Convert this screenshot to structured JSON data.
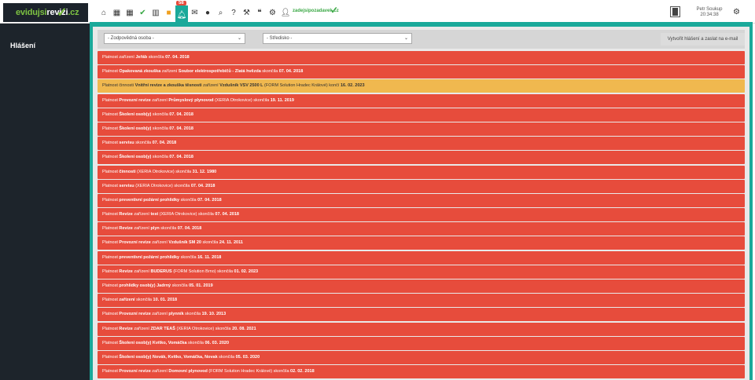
{
  "logo": {
    "part1": "evidujsi",
    "part2": "revizi",
    "part3": ".cz"
  },
  "topbar": {
    "notification_count": "58",
    "zadej_label": "zadejsipozadavek",
    "zadej_suffix": ".cz",
    "user_name": "Petr Soukup",
    "user_time": "20:34:38",
    "icons": [
      "home-icon",
      "calendar-icon",
      "calendar-icon",
      "check-icon",
      "bar-chart-icon",
      "folder-icon",
      "bell-icon",
      "envelope-icon",
      "info-icon",
      "search-icon",
      "help-icon",
      "gavel-icon",
      "quote-icon",
      "cog-icon",
      "user-icon"
    ]
  },
  "sidebar": {
    "title": "Hlášení"
  },
  "filters": {
    "responsible_person": "- Zodpovědná osoba -",
    "center": "- Středisko -",
    "send_button": "Vytvořit hlášení a zaslat na e-mail"
  },
  "colors": {
    "red": "#e74c3c",
    "yellow": "#f0b84f",
    "teal": "#1aa99a",
    "dark": "#1d242b"
  },
  "reports": [
    {
      "color": "red",
      "parts": [
        [
          "Platnost zařízení ",
          false
        ],
        [
          "Jeřáb",
          true
        ],
        [
          " skončila ",
          false
        ],
        [
          "07. 04. 2018",
          true
        ]
      ]
    },
    {
      "color": "red",
      "parts": [
        [
          "Platnost ",
          false
        ],
        [
          "Opakovaná zkouška",
          true
        ],
        [
          " zařízení ",
          false
        ],
        [
          "Soubor elektrospotřebičů - Zlatá hvězda",
          true
        ],
        [
          " skončila ",
          false
        ],
        [
          "07. 04. 2018",
          true
        ]
      ]
    },
    {
      "color": "yellow",
      "parts": [
        [
          "Platnost činnosti ",
          false
        ],
        [
          "Vnitřní revize a zkouška těsnosti",
          true
        ],
        [
          " zařízení ",
          false
        ],
        [
          "Vzdušník VSV 2500 L",
          true
        ],
        [
          " (FORM Solution Hradec Králové) končí ",
          false
        ],
        [
          "16. 02. 2023",
          true
        ]
      ]
    },
    {
      "color": "red",
      "parts": [
        [
          "Platnost ",
          false
        ],
        [
          "Provozní revize",
          true
        ],
        [
          " zařízení ",
          false
        ],
        [
          "Průmyslový plynovod",
          true
        ],
        [
          " (XERIA Otrokovice) skončila ",
          false
        ],
        [
          "19. 11. 2019",
          true
        ]
      ]
    },
    {
      "color": "red",
      "parts": [
        [
          "Platnost ",
          false
        ],
        [
          "Školení osob(y)",
          true
        ],
        [
          " skončila ",
          false
        ],
        [
          "07. 04. 2018",
          true
        ]
      ]
    },
    {
      "color": "red",
      "parts": [
        [
          "Platnost ",
          false
        ],
        [
          "Školení osob(y)",
          true
        ],
        [
          " skončila ",
          false
        ],
        [
          "07. 04. 2018",
          true
        ]
      ]
    },
    {
      "color": "red",
      "parts": [
        [
          "Platnost ",
          false
        ],
        [
          "servisu",
          true
        ],
        [
          " skončila ",
          false
        ],
        [
          "07. 04. 2018",
          true
        ]
      ]
    },
    {
      "color": "red",
      "parts": [
        [
          "Platnost ",
          false
        ],
        [
          "Školení osob(y)",
          true
        ],
        [
          " skončila ",
          false
        ],
        [
          "07. 04. 2018",
          true
        ]
      ]
    },
    {
      "color": "red",
      "parts": [
        [
          "Platnost ",
          false
        ],
        [
          "činnosti",
          true
        ],
        [
          " (XERIA Otrokovice) skončila ",
          false
        ],
        [
          "31. 12. 1980",
          true
        ]
      ]
    },
    {
      "color": "red",
      "parts": [
        [
          "Platnost ",
          false
        ],
        [
          "servisu",
          true
        ],
        [
          " (XERIA Otrokovice) skončila ",
          false
        ],
        [
          "07. 04. 2018",
          true
        ]
      ]
    },
    {
      "color": "red",
      "parts": [
        [
          "Platnost ",
          false
        ],
        [
          "preventivní požární prohlídky",
          true
        ],
        [
          " skončila ",
          false
        ],
        [
          "07. 04. 2018",
          true
        ]
      ]
    },
    {
      "color": "red",
      "parts": [
        [
          "Platnost ",
          false
        ],
        [
          "Revize",
          true
        ],
        [
          " zařízení ",
          false
        ],
        [
          "test",
          true
        ],
        [
          " (XERIA Otrokovice) skončila ",
          false
        ],
        [
          "07. 04. 2018",
          true
        ]
      ]
    },
    {
      "color": "red",
      "parts": [
        [
          "Platnost ",
          false
        ],
        [
          "Revize",
          true
        ],
        [
          " zařízení ",
          false
        ],
        [
          "plyn",
          true
        ],
        [
          " skončila ",
          false
        ],
        [
          "07. 04. 2018",
          true
        ]
      ]
    },
    {
      "color": "red",
      "parts": [
        [
          "Platnost ",
          false
        ],
        [
          "Provozní revize",
          true
        ],
        [
          " zařízení ",
          false
        ],
        [
          "Vzdušník SM 20",
          true
        ],
        [
          " skončila ",
          false
        ],
        [
          "24. 11. 2011",
          true
        ]
      ]
    },
    {
      "color": "red",
      "parts": [
        [
          "Platnost ",
          false
        ],
        [
          "preventivní požární prohlídky",
          true
        ],
        [
          " skončila ",
          false
        ],
        [
          "16. 11. 2018",
          true
        ]
      ]
    },
    {
      "color": "red",
      "parts": [
        [
          "Platnost ",
          false
        ],
        [
          "Revize",
          true
        ],
        [
          " zařízení ",
          false
        ],
        [
          "BUDERUS",
          true
        ],
        [
          " (FORM Solution Brno) skončila ",
          false
        ],
        [
          "01. 02. 2023",
          true
        ]
      ]
    },
    {
      "color": "red",
      "parts": [
        [
          "Platnost ",
          false
        ],
        [
          "prohlídky osob(y)",
          true
        ],
        [
          " ",
          false
        ],
        [
          "Jadrný",
          true
        ],
        [
          " skončila ",
          false
        ],
        [
          "05. 01. 2019",
          true
        ]
      ]
    },
    {
      "color": "red",
      "parts": [
        [
          "Platnost ",
          false
        ],
        [
          "zařízení",
          true
        ],
        [
          " skončila ",
          false
        ],
        [
          "10. 01. 2018",
          true
        ]
      ]
    },
    {
      "color": "red",
      "parts": [
        [
          "Platnost ",
          false
        ],
        [
          "Provozní revize",
          true
        ],
        [
          " zařízení ",
          false
        ],
        [
          "plynník",
          true
        ],
        [
          " skončila ",
          false
        ],
        [
          "19. 10. 2013",
          true
        ]
      ]
    },
    {
      "color": "red",
      "parts": [
        [
          "Platnost ",
          false
        ],
        [
          "Revize",
          true
        ],
        [
          " zařízení ",
          false
        ],
        [
          "ZDAR TEAŠ",
          true
        ],
        [
          " (XERIA Otrokovice) skončila ",
          false
        ],
        [
          "20. 08. 2021",
          true
        ]
      ]
    },
    {
      "color": "red",
      "parts": [
        [
          "Platnost ",
          false
        ],
        [
          "Školení osob(y)",
          true
        ],
        [
          " ",
          false
        ],
        [
          "Kvítko, Vomáčka",
          true
        ],
        [
          " skončila ",
          false
        ],
        [
          "06. 03. 2020",
          true
        ]
      ]
    },
    {
      "color": "red",
      "parts": [
        [
          "Platnost ",
          false
        ],
        [
          "Školení osob(y)",
          true
        ],
        [
          " ",
          false
        ],
        [
          "Novák, Kvítko, Vomáčka, Novak",
          true
        ],
        [
          " skončila ",
          false
        ],
        [
          "05. 03. 2020",
          true
        ]
      ]
    },
    {
      "color": "red",
      "parts": [
        [
          "Platnost ",
          false
        ],
        [
          "Provozní revize",
          true
        ],
        [
          " zařízení ",
          false
        ],
        [
          "Domovní plynovod",
          true
        ],
        [
          " (FORM Solution Hradec Králové) skončila ",
          false
        ],
        [
          "02. 02. 2018",
          true
        ]
      ]
    }
  ]
}
